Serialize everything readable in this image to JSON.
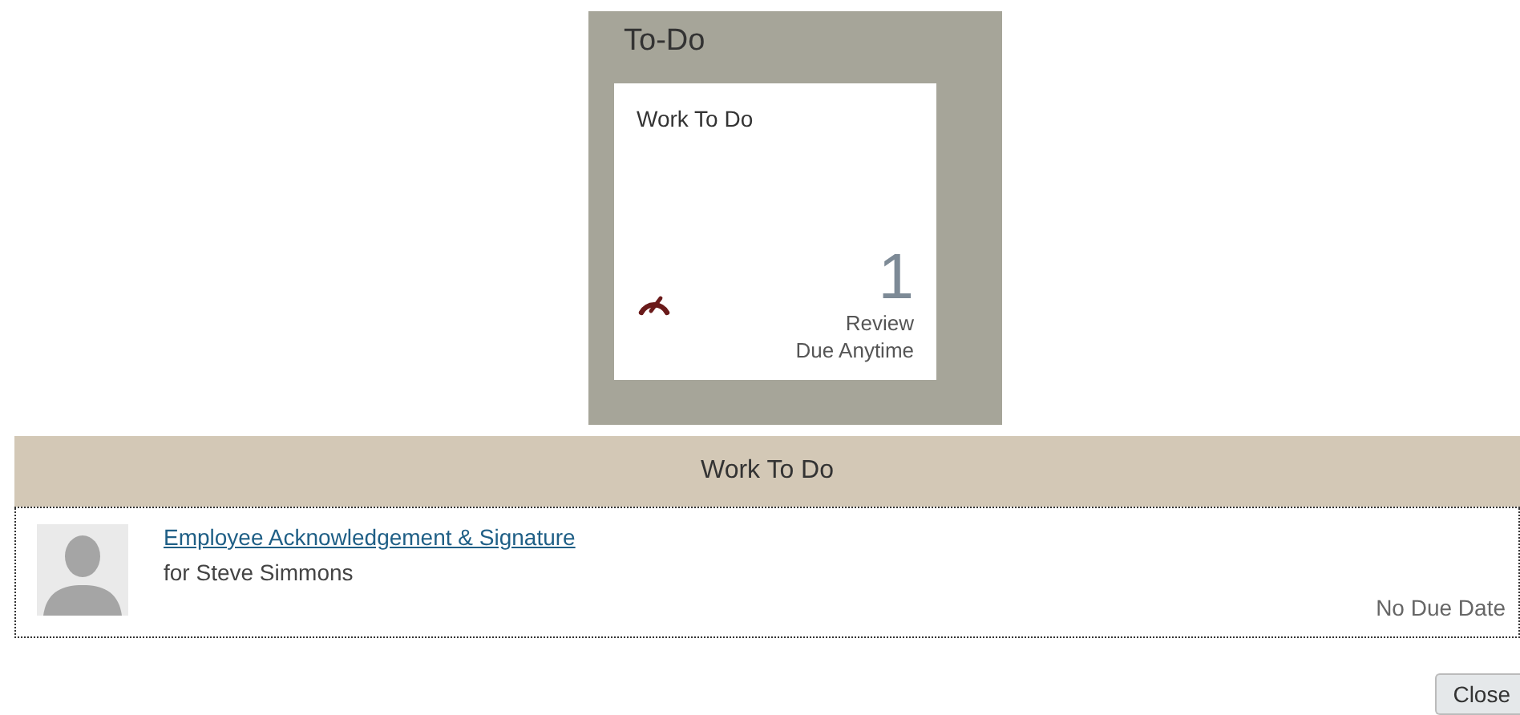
{
  "panel": {
    "title": "To-Do",
    "tile": {
      "title": "Work To Do",
      "count": "1",
      "label": "Review",
      "due": "Due Anytime"
    }
  },
  "dialog": {
    "title": "Work To Do",
    "items": [
      {
        "link": "Employee Acknowledgement & Signature",
        "subtitle": "for Steve Simmons",
        "due": "No Due Date"
      }
    ],
    "buttons": [
      "Close"
    ]
  }
}
